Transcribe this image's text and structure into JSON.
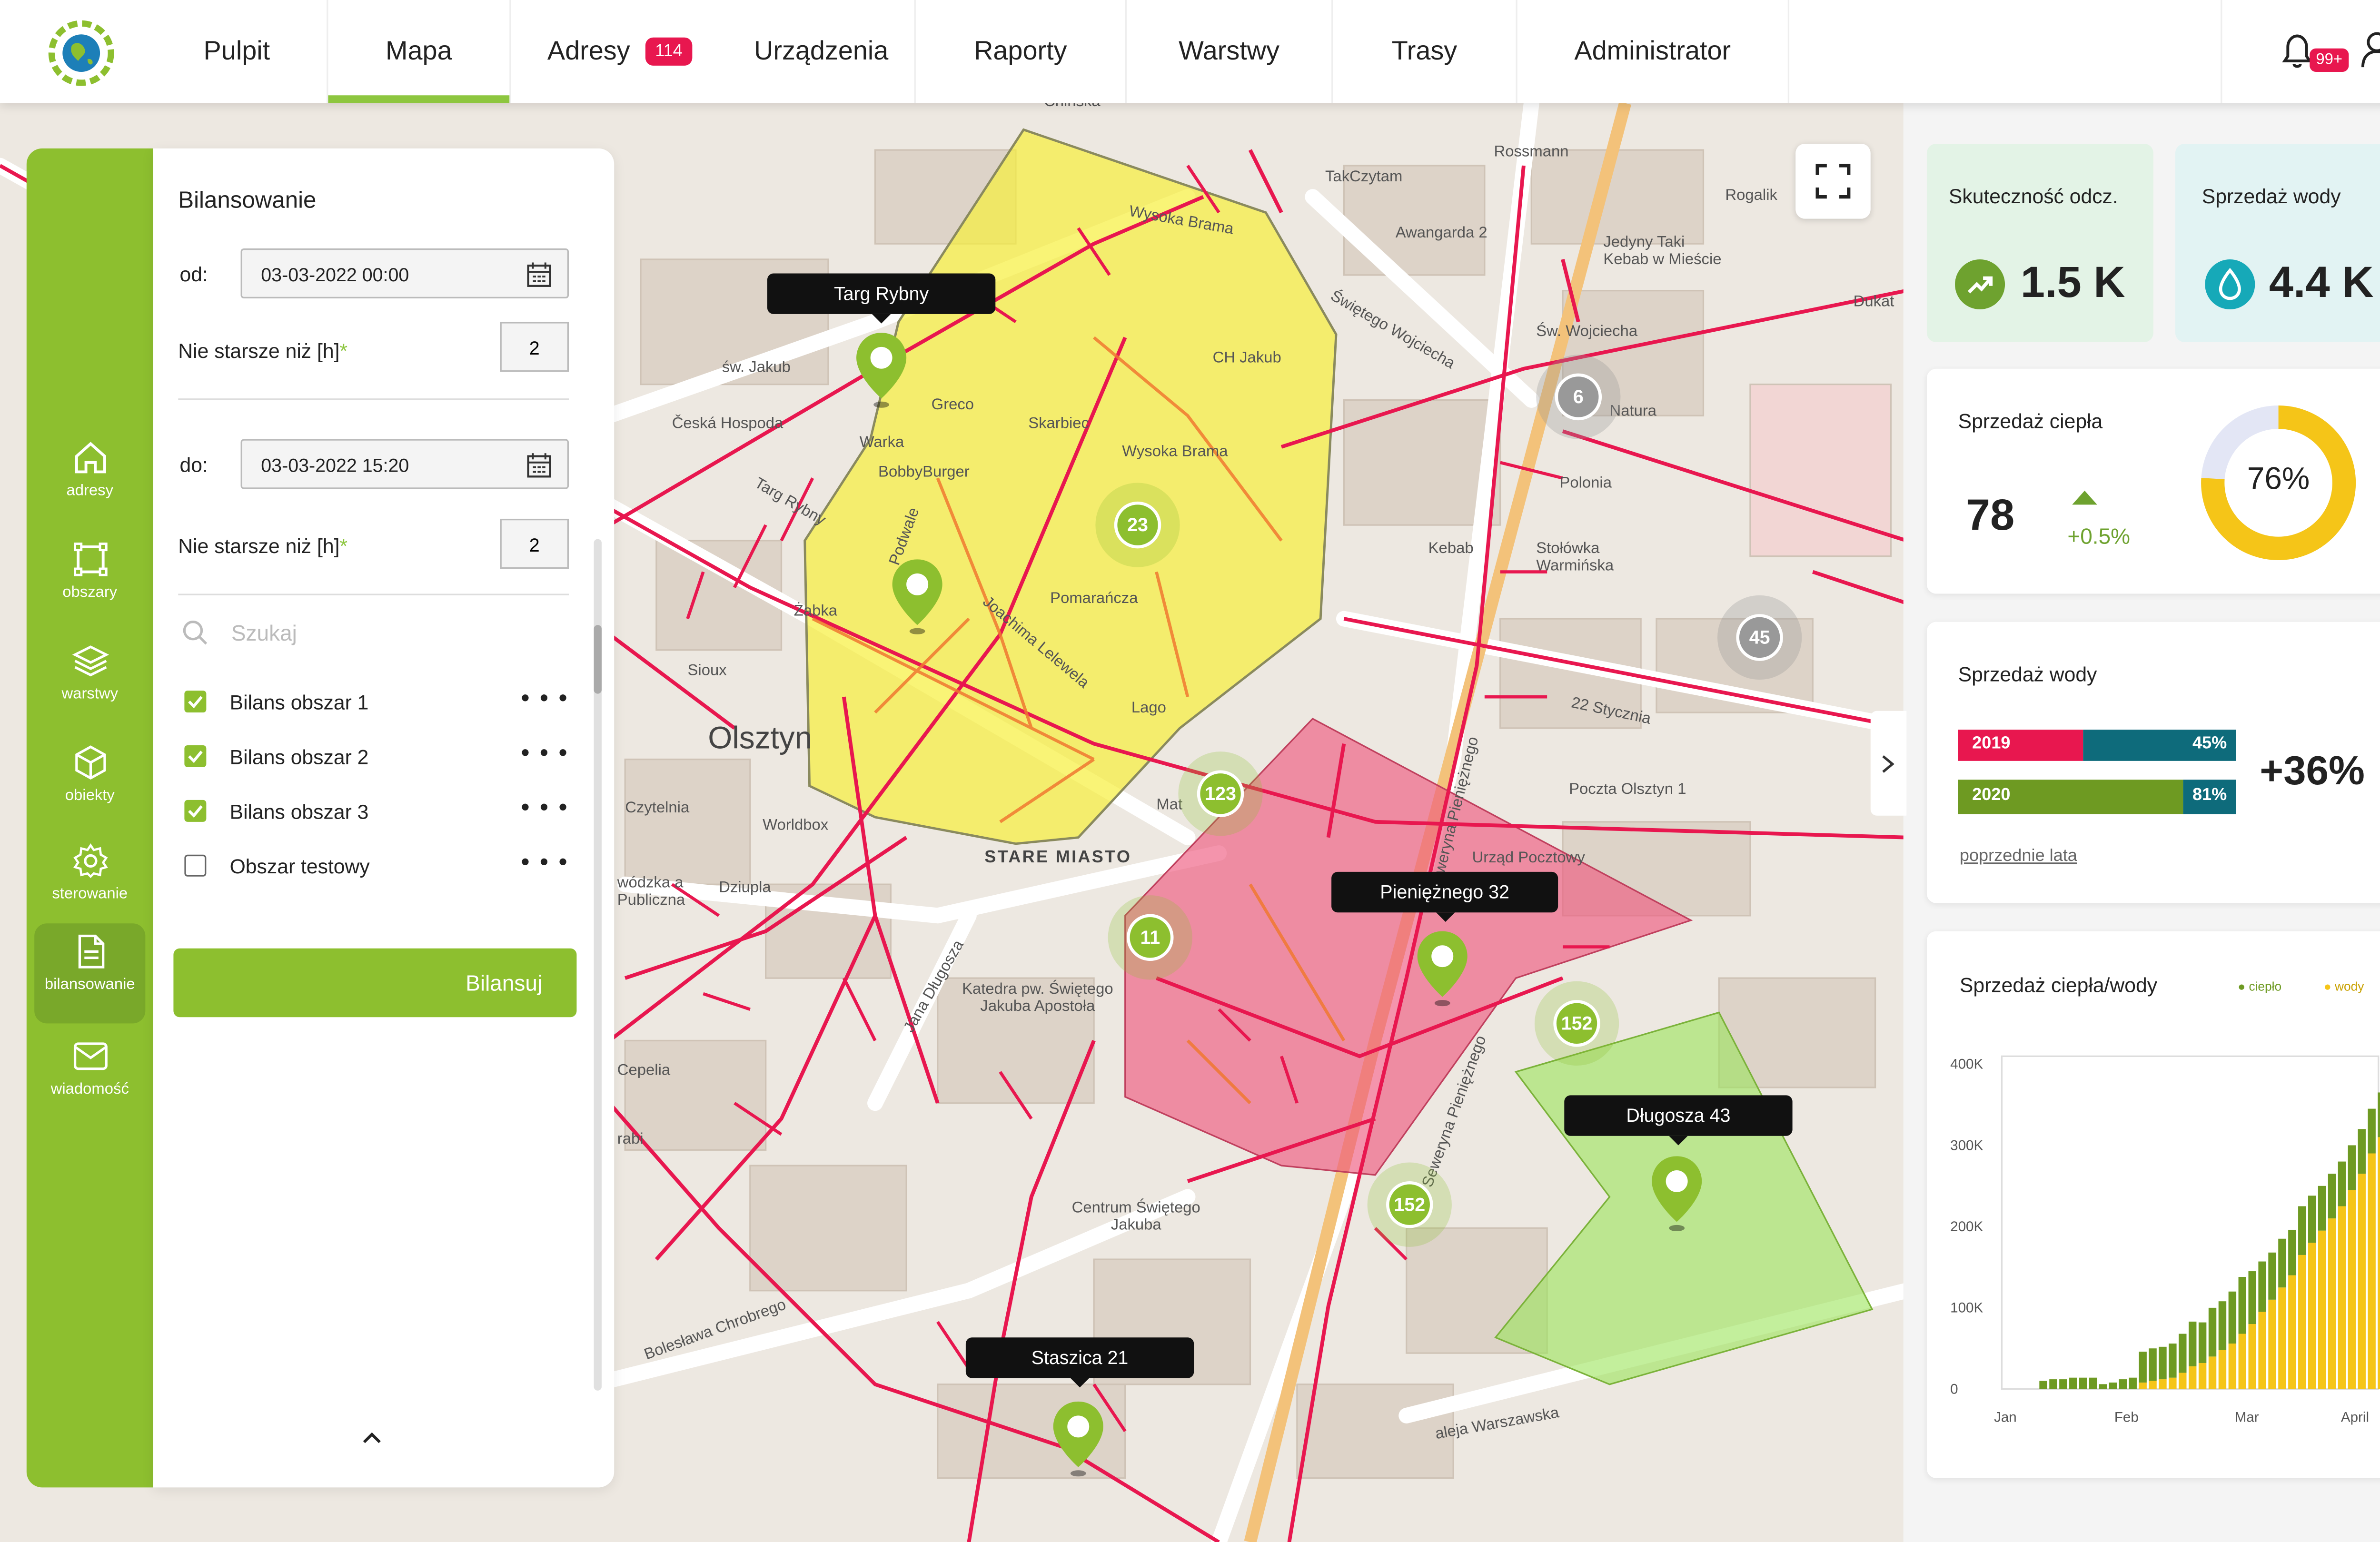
{
  "nav": {
    "items": [
      {
        "label": "Pulpit"
      },
      {
        "label": "Mapa"
      },
      {
        "label": "Adresy",
        "badge": "114"
      },
      {
        "label": "Urządzenia"
      },
      {
        "label": "Raporty"
      },
      {
        "label": "Warstwy"
      },
      {
        "label": "Trasy"
      },
      {
        "label": "Administrator"
      }
    ],
    "active": "Mapa",
    "notifications_badge": "99+"
  },
  "rail": {
    "items": [
      {
        "label": "adresy",
        "icon": "home-icon"
      },
      {
        "label": "obszary",
        "icon": "area-icon"
      },
      {
        "label": "warstwy",
        "icon": "layers-icon"
      },
      {
        "label": "obiekty",
        "icon": "cube-icon"
      },
      {
        "label": "sterowanie",
        "icon": "gear-icon"
      },
      {
        "label": "bilansowanie",
        "icon": "document-icon"
      },
      {
        "label": "wiadomość",
        "icon": "mail-icon"
      }
    ],
    "active": "bilansowanie"
  },
  "panel": {
    "title": "Bilansowanie",
    "from_label": "od:",
    "from_value": "03-03-2022 00:00",
    "from_max_age_label": "Nie starsze niż [h]",
    "from_max_age_value": "2",
    "to_label": "do:",
    "to_value": "03-03-2022 15:20",
    "to_max_age_label": "Nie starsze niż [h]",
    "to_max_age_value": "2",
    "required_mark": "*",
    "search_placeholder": "Szukaj",
    "items": [
      {
        "label": "Bilans obszar 1",
        "checked": true
      },
      {
        "label": "Bilans obszar 2",
        "checked": true
      },
      {
        "label": "Bilans obszar 3",
        "checked": true
      },
      {
        "label": "Obszar testowy",
        "checked": false
      }
    ],
    "more": "• • •",
    "button": "Bilansuj"
  },
  "map": {
    "tooltips": [
      "Targ Rybny",
      "Pieniężnego 32",
      "Długosza 43",
      "Staszica 21"
    ],
    "clusters": [
      "23",
      "123",
      "11",
      "152",
      "152",
      "6",
      "45"
    ],
    "labels": {
      "l1": "św. Jakub",
      "l2": "Česká Hospoda",
      "l3": "Greco",
      "l4": "Skarbiec",
      "l5": "Warka",
      "l6": "BobbyBurger",
      "l7": "Targ Rybny",
      "l8": "Żabka",
      "l9": "Pomarańcza",
      "l10": "Lago",
      "l11": "Sioux",
      "l12": "Olsztyn",
      "l13": "Czytelnia",
      "l14": "Worldbox",
      "l15": "STARE MIASTO",
      "l16": "Dziupla",
      "l17": "Cepelia",
      "l18": "Katedra pw. Świętego Jakuba Apostoła",
      "l19": "Centrum Świętego Jakuba",
      "l20": "Bolesława Chrobrego",
      "l21": "Wysoka Brama",
      "l22": "CH Jakub",
      "l23": "TakCzytam",
      "l24": "Awangarda 2",
      "l25": "Rossmann",
      "l26": "Rogalik",
      "l27": "Jedyny Taki Kebab w Mieście",
      "l28": "Św. Wojciecha",
      "l29": "Natura",
      "l30": "Polonia",
      "l31": "Kebab",
      "l32": "Stołówka Warmińska",
      "l33": "22 Stycznia",
      "l34": "Poczta Olsztyn 1",
      "l35": "Urząd Pocztowy",
      "l36": "Seweryna Pieniężnego",
      "l37": "Jana Długosza",
      "l38": "aleja Warszawska",
      "l39": "Dukat",
      "l40": "Mat",
      "l41": "Wysoka Brama",
      "l42": "wódzka a Publiczna",
      "l43": "rabi",
      "l44": "Świętego Wojciecha",
      "l45": "Podwale",
      "l46": "Joachima Lelewela",
      "l47": "Seweryna Pieniężnego",
      "l48": "Chińska"
    }
  },
  "kpis": [
    {
      "title": "Skuteczność odcz.",
      "value": "1.5 K",
      "icon": "trend-up-icon",
      "bg": "#e3f3e6",
      "icon_color": "#6ea22f"
    },
    {
      "title": "Sprzedaż wody",
      "value": "4.4 K",
      "icon": "water-drop-icon",
      "bg": "#e2f3f3",
      "icon_color": "#16a9b8"
    }
  ],
  "heat_sales": {
    "title": "Sprzedaż ciepła",
    "value": "78",
    "change": "+0.5%",
    "percent_label": "76%",
    "percent": 0.76,
    "colors": {
      "fill": "#f5c518",
      "track": "#e3e6f5"
    }
  },
  "water_sales": {
    "title": "Sprzedaż wody",
    "rows": [
      {
        "year": "2019",
        "pct_label": "45%",
        "fill": 0.45,
        "fill_color": "#e8174f",
        "rest_color": "#0e6b7b"
      },
      {
        "year": "2020",
        "pct_label": "81%",
        "fill": 0.81,
        "fill_color": "#6e9a22",
        "rest_color": "#0e6b7b"
      }
    ],
    "delta": "+36%",
    "link": "poprzednie lata"
  },
  "chart_data": {
    "type": "bar",
    "title": "Sprzedaż ciepła/wody",
    "stacked": true,
    "x": [
      "Jan",
      "Feb",
      "Mar",
      "April"
    ],
    "ylim": [
      0,
      400000
    ],
    "yticks": [
      "0",
      "100K",
      "200K",
      "300K",
      "400K"
    ],
    "legend": [
      {
        "name": "ciepło",
        "color": "#6e9a22"
      },
      {
        "name": "wody",
        "color": "#f5c518"
      }
    ],
    "legend_position": "top-right",
    "series": [
      {
        "name": "wody",
        "color": "#f5c518",
        "values": [
          0,
          0,
          0,
          0,
          0,
          0,
          0,
          0,
          0,
          0,
          8000,
          10000,
          12000,
          14000,
          20000,
          28000,
          32000,
          40000,
          48000,
          56000,
          68000,
          80000,
          95000,
          110000,
          125000,
          140000,
          165000,
          180000,
          195000,
          210000,
          225000,
          245000,
          265000,
          290000,
          310000,
          325000
        ]
      },
      {
        "name": "ciepło",
        "color": "#6e9a22",
        "values": [
          10000,
          12000,
          12000,
          14000,
          14000,
          14000,
          6000,
          8000,
          12000,
          14000,
          38000,
          40000,
          40000,
          42000,
          48000,
          55000,
          50000,
          60000,
          60000,
          64000,
          70000,
          65000,
          62000,
          58000,
          60000,
          56000,
          60000,
          58000,
          55000,
          55000,
          55000,
          55000,
          55000,
          55000,
          55000,
          57000
        ]
      }
    ]
  }
}
